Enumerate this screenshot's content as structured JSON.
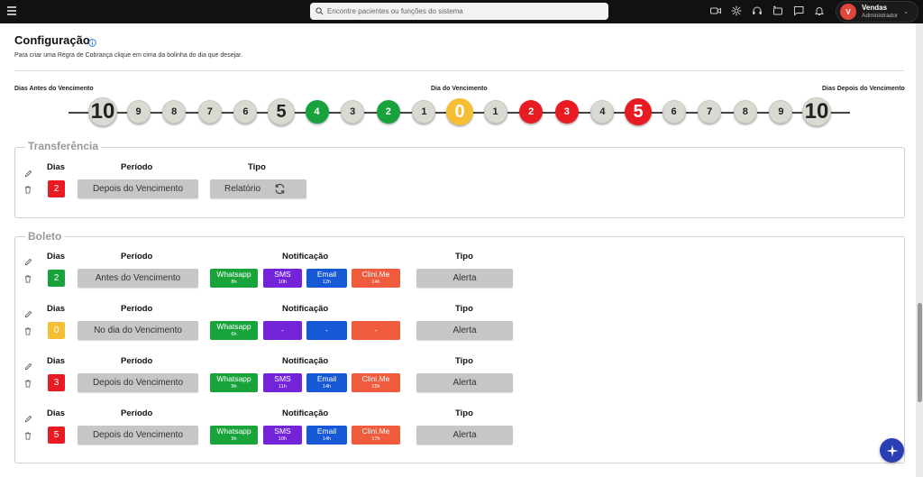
{
  "topbar": {
    "search_placeholder": "Encontre pacientes ou funções do sistema",
    "icons": [
      "video-icon",
      "settings-icon",
      "headset-icon",
      "message-icon",
      "chat-icon",
      "bell-icon"
    ],
    "user": {
      "initial": "V",
      "name": "Vendas",
      "role": "Administrador"
    }
  },
  "page": {
    "title": "Configuração",
    "subtitle": "Para criar uma Regra de Cobrança clique em cima da bolinha do dia que desejar."
  },
  "timeline": {
    "label_before": "Dias Antes do Vencimento",
    "label_due": "Dia do Vencimento",
    "label_after": "Dias Depois do Vencimento",
    "days": [
      {
        "n": "10",
        "style": "gray",
        "size": "lg"
      },
      {
        "n": "9",
        "style": "gray",
        "size": "sm"
      },
      {
        "n": "8",
        "style": "gray",
        "size": "sm"
      },
      {
        "n": "7",
        "style": "gray",
        "size": "sm"
      },
      {
        "n": "6",
        "style": "gray",
        "size": "sm"
      },
      {
        "n": "5",
        "style": "gray",
        "size": "md"
      },
      {
        "n": "4",
        "style": "green",
        "size": "sm"
      },
      {
        "n": "3",
        "style": "gray",
        "size": "sm"
      },
      {
        "n": "2",
        "style": "green",
        "size": "sm"
      },
      {
        "n": "1",
        "style": "gray",
        "size": "sm"
      },
      {
        "n": "0",
        "style": "yellow",
        "size": "md"
      },
      {
        "n": "1",
        "style": "gray",
        "size": "sm"
      },
      {
        "n": "2",
        "style": "red",
        "size": "sm"
      },
      {
        "n": "3",
        "style": "red",
        "size": "sm"
      },
      {
        "n": "4",
        "style": "gray",
        "size": "sm"
      },
      {
        "n": "5",
        "style": "red",
        "size": "md"
      },
      {
        "n": "6",
        "style": "gray",
        "size": "sm"
      },
      {
        "n": "7",
        "style": "gray",
        "size": "sm"
      },
      {
        "n": "8",
        "style": "gray",
        "size": "sm"
      },
      {
        "n": "9",
        "style": "gray",
        "size": "sm"
      },
      {
        "n": "10",
        "style": "gray",
        "size": "lg"
      }
    ]
  },
  "transferencia": {
    "title": "Transferência",
    "headers": {
      "dias": "Dias",
      "periodo": "Período",
      "tipo": "Tipo"
    },
    "rule": {
      "dias": "2",
      "color": "red",
      "periodo": "Depois do Vencimento",
      "tipo": "Relatório"
    }
  },
  "boleto": {
    "title": "Boleto",
    "headers": {
      "dias": "Dias",
      "periodo": "Período",
      "notificacao": "Notificação",
      "tipo": "Tipo"
    },
    "rules": [
      {
        "dias": "2",
        "color": "green",
        "periodo": "Antes do Vencimento",
        "tipo": "Alerta",
        "notif": [
          {
            "label": "Whatsapp",
            "time": "8h"
          },
          {
            "label": "SMS",
            "time": "10h"
          },
          {
            "label": "Email",
            "time": "12h"
          },
          {
            "label": "Clini.Me",
            "time": "14h"
          }
        ]
      },
      {
        "dias": "0",
        "color": "yellow",
        "periodo": "No dia do Vencimento",
        "tipo": "Alerta",
        "notif": [
          {
            "label": "Whatsapp",
            "time": "6h"
          },
          {
            "label": "-",
            "time": ""
          },
          {
            "label": "-",
            "time": ""
          },
          {
            "label": "-",
            "time": ""
          }
        ]
      },
      {
        "dias": "3",
        "color": "red",
        "periodo": "Depois do Vencimento",
        "tipo": "Alerta",
        "notif": [
          {
            "label": "Whatsapp",
            "time": "9h"
          },
          {
            "label": "SMS",
            "time": "11h"
          },
          {
            "label": "Email",
            "time": "14h"
          },
          {
            "label": "Clini.Me",
            "time": "15h"
          }
        ]
      },
      {
        "dias": "5",
        "color": "red",
        "periodo": "Depois do Vencimento",
        "tipo": "Alerta",
        "notif": [
          {
            "label": "Whatsapp",
            "time": "9h"
          },
          {
            "label": "SMS",
            "time": "10h"
          },
          {
            "label": "Email",
            "time": "14h"
          },
          {
            "label": "Clini.Me",
            "time": "17h"
          }
        ]
      }
    ]
  },
  "colors": {
    "green": "#17a23b",
    "red": "#e81b23",
    "yellow": "#f5be34",
    "whatsapp": "#18a43b",
    "sms": "#7424d8",
    "email": "#1658d6",
    "clinime": "#f05b3d"
  }
}
